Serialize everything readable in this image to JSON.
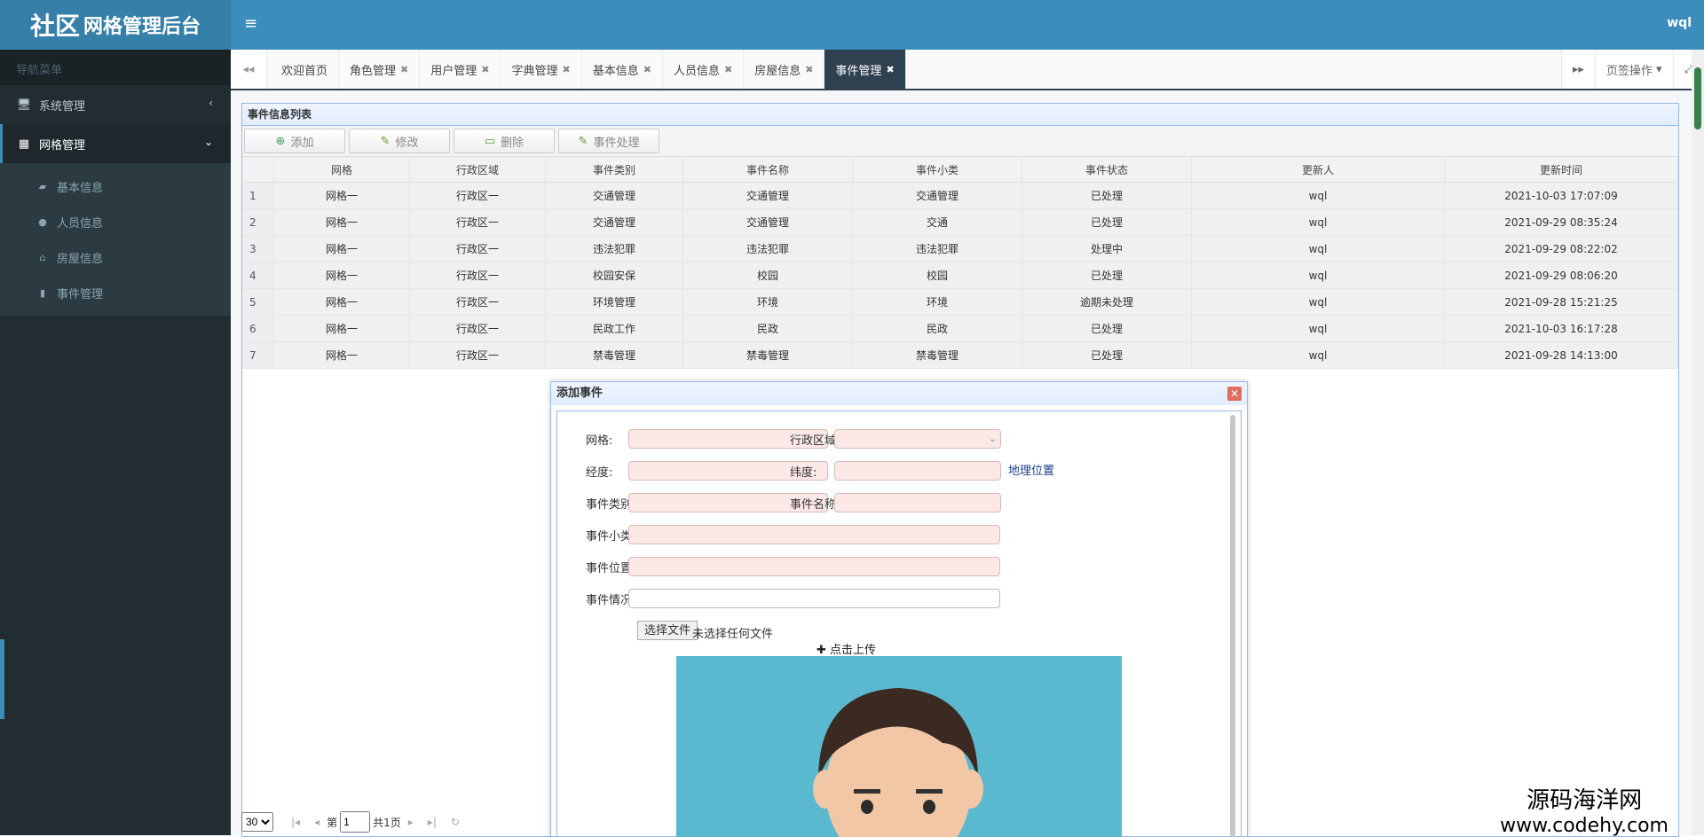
{
  "header": {
    "logo_big": "社区",
    "logo_small": "网格管理后台",
    "menu_toggle": "≡",
    "user": "wql"
  },
  "sidebar": {
    "nav_title": "导航菜单",
    "system": "系统管理",
    "grid": "网格管理",
    "subitems": [
      "基本信息",
      "人员信息",
      "房屋信息",
      "事件管理"
    ]
  },
  "tabs": {
    "items": [
      "欢迎首页",
      "角色管理",
      "用户管理",
      "字典管理",
      "基本信息",
      "人员信息",
      "房屋信息",
      "事件管理"
    ],
    "active_index": 7,
    "page_ops": "页签操作"
  },
  "panel": {
    "title": "事件信息列表",
    "toolbar": [
      "添加",
      "修改",
      "删除",
      "事件处理"
    ]
  },
  "table": {
    "headers": [
      "网格",
      "行政区域",
      "事件类别",
      "事件名称",
      "事件小类",
      "事件状态",
      "更新人",
      "更新时间"
    ],
    "rows": [
      [
        "1",
        "网格一",
        "行政区一",
        "交通管理",
        "交通管理",
        "交通管理",
        "已处理",
        "wql",
        "2021-10-03 17:07:09"
      ],
      [
        "2",
        "网格一",
        "行政区一",
        "交通管理",
        "交通管理",
        "交通",
        "已处理",
        "wql",
        "2021-09-29 08:35:24"
      ],
      [
        "3",
        "网格一",
        "行政区一",
        "违法犯罪",
        "违法犯罪",
        "违法犯罪",
        "处理中",
        "wql",
        "2021-09-29 08:22:02"
      ],
      [
        "4",
        "网格一",
        "行政区一",
        "校园安保",
        "校园",
        "校园",
        "已处理",
        "wql",
        "2021-09-29 08:06:20"
      ],
      [
        "5",
        "网格一",
        "行政区一",
        "环境管理",
        "环境",
        "环境",
        "逾期未处理",
        "wql",
        "2021-09-28 15:21:25"
      ],
      [
        "6",
        "网格一",
        "行政区一",
        "民政工作",
        "民政",
        "民政",
        "已处理",
        "wql",
        "2021-10-03 16:17:28"
      ],
      [
        "7",
        "网格一",
        "行政区一",
        "禁毒管理",
        "禁毒管理",
        "禁毒管理",
        "已处理",
        "wql",
        "2021-09-28 14:13:00"
      ]
    ]
  },
  "pager": {
    "page_size": "30",
    "page_prefix": "第",
    "page_value": "1",
    "page_total": "共1页"
  },
  "dialog": {
    "title": "添加事件",
    "labels": {
      "grid": "网格:",
      "region": "行政区域:",
      "lng": "经度:",
      "lat": "纬度:",
      "geo_link": "地理位置",
      "category": "事件类别:",
      "name": "事件名称:",
      "subtype": "事件小类:",
      "location": "事件位置:",
      "situation": "事件情况:"
    },
    "file_button": "选择文件",
    "file_status": "未选择任何文件",
    "upload": "✚ 点击上传"
  },
  "watermark": {
    "line1": "源码海洋网",
    "line2": "www.codehy.com"
  },
  "colors": {
    "header": "#3c8dbc",
    "sidebar": "#222d32",
    "active_tab": "#2f4050",
    "required_field": "#fde8e8"
  }
}
